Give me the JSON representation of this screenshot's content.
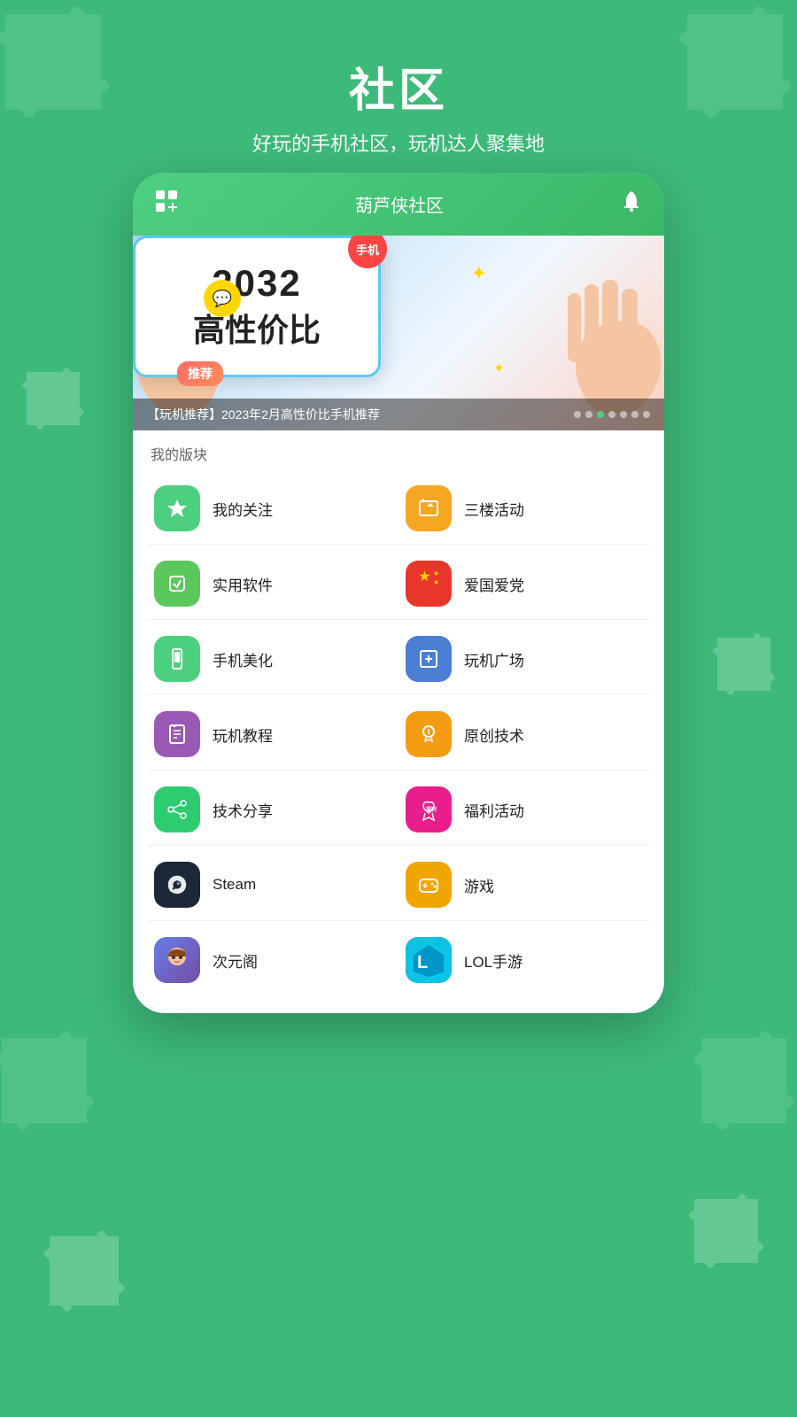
{
  "page": {
    "title": "社区",
    "subtitle": "好玩的手机社区，玩机达人聚集地"
  },
  "app": {
    "header_title": "葫芦侠社区",
    "section_my_blocks": "我的版块"
  },
  "banner": {
    "year": "2032",
    "text": "高性价比",
    "tag": "手机",
    "recommend_badge": "推荐",
    "caption": "【玩机推荐】2023年2月高性价比手机推荐",
    "dots": [
      1,
      2,
      3,
      4,
      5,
      6,
      7
    ],
    "active_dot": 3
  },
  "menu_items": [
    {
      "id": "my-follow",
      "label": "我的关注",
      "icon": "★",
      "icon_class": "icon-green",
      "col": 0
    },
    {
      "id": "3f-activity",
      "label": "三楼活动",
      "icon": "⚑",
      "icon_class": "icon-yellow",
      "col": 1
    },
    {
      "id": "useful-software",
      "label": "实用软件",
      "icon": "◈",
      "icon_class": "icon-light-green",
      "col": 0
    },
    {
      "id": "patriot",
      "label": "爱国爱党",
      "icon": "★",
      "icon_class": "icon-red",
      "col": 1
    },
    {
      "id": "phone-beauty",
      "label": "手机美化",
      "icon": "▦",
      "icon_class": "icon-green2",
      "col": 0
    },
    {
      "id": "play-square",
      "label": "玩机广场",
      "icon": "📱",
      "icon_class": "icon-blue",
      "col": 1
    },
    {
      "id": "play-tutorial",
      "label": "玩机教程",
      "icon": "📖",
      "icon_class": "icon-purple",
      "col": 0
    },
    {
      "id": "original-tech",
      "label": "原创技术",
      "icon": "💡",
      "icon_class": "icon-orange",
      "col": 1
    },
    {
      "id": "tech-share",
      "label": "技术分享",
      "icon": "🔧",
      "icon_class": "icon-teal",
      "col": 0
    },
    {
      "id": "welfare",
      "label": "福利活动",
      "icon": "🎁",
      "icon_class": "icon-pink",
      "col": 1
    },
    {
      "id": "steam",
      "label": "Steam",
      "icon": "S",
      "icon_class": "icon-dark-blue",
      "col": 0
    },
    {
      "id": "games",
      "label": "游戏",
      "icon": "🎮",
      "icon_class": "icon-gold",
      "col": 1
    },
    {
      "id": "anime",
      "label": "次元阁",
      "icon": "⛩",
      "icon_class": "icon-anime",
      "col": 0
    },
    {
      "id": "lol-mobile",
      "label": "LOL手游",
      "icon": "L",
      "icon_class": "icon-lol",
      "col": 1
    }
  ]
}
